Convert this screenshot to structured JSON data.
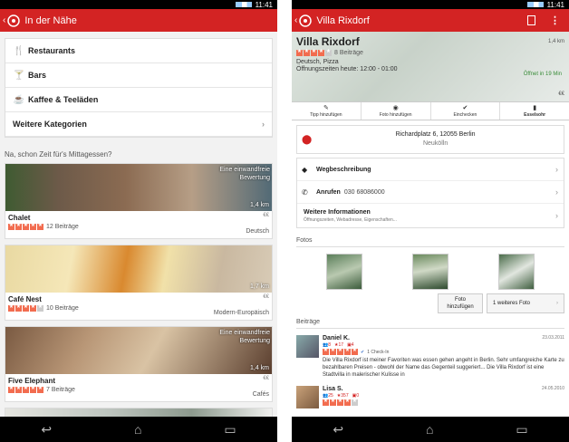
{
  "status": {
    "time_left": "11:41",
    "time_right": "11:41"
  },
  "p1": {
    "title": "In der Nähe",
    "categories": [
      {
        "icon": "fork-knife-icon",
        "glyph": "🍴",
        "label": "Restaurants"
      },
      {
        "icon": "cocktail-icon",
        "glyph": "🍸",
        "label": "Bars"
      },
      {
        "icon": "coffee-cup-icon",
        "glyph": "☕",
        "label": "Kaffee & Teeläden"
      }
    ],
    "more_categories": "Weitere Kategorien",
    "section_title": "Na, schon Zeit für's Mittagessen?",
    "cards": [
      {
        "name": "Chalet",
        "reviews": "12 Beiträge",
        "price": "€€",
        "cuisine": "Deutsch",
        "distance": "1,4 km",
        "badge": "Eine einwandfreie Bewertung",
        "rating": 5
      },
      {
        "name": "Café Nest",
        "reviews": "10 Beiträge",
        "price": "€€",
        "cuisine": "Modern-Europäisch",
        "distance": "1,7 km",
        "badge": "",
        "rating": 4
      },
      {
        "name": "Five Elephant",
        "reviews": "7 Beiträge",
        "price": "€€",
        "cuisine": "Cafés",
        "distance": "1,4 km",
        "badge": "Eine einwandfreie Bewertung",
        "rating": 5
      }
    ]
  },
  "p2": {
    "title": "Villa Rixdorf",
    "name": "Villa Rixdorf",
    "distance": "1,4 km",
    "reviews": "8 Beiträge",
    "price": "€€",
    "rating": 4,
    "categories": "Deutsch, Pizza",
    "hours": "Öffnungszeiten heute: 12:00 - 01:00",
    "opens_in": "Öffnet in 19 Min",
    "actions": [
      "Tipp hinzufügen",
      "Foto hinzufügen",
      "Einchecken",
      "Esselsohr"
    ],
    "address1": "Richardplatz 6, 12055 Berlin",
    "address2": "Neukölln",
    "directions": "Wegbeschreibung",
    "call_label": "Anrufen",
    "phone": "030 68086000",
    "more_info": "Weitere Informationen",
    "more_info_sub": "Öffnungszeiten, Webadresse, Eigenschaften...",
    "photos_title": "Fotos",
    "add_photo": "Foto hinzufügen",
    "more_photos": "1 weiteres Foto",
    "reviews_title": "Beiträge",
    "review1": {
      "name": "Daniel K.",
      "date": "23.03.2011",
      "friends": "8",
      "reviews_count": "17",
      "photos": "4",
      "checkin": "1 Check-In",
      "rating": 5,
      "text": "Die Villa Rixdorf ist meiner Favoriten was essen gehen angeht in Berlin. Sehr umfangreiche Karte zu bezahlbaren Preisen - obwohl der Name das Gegenteil suggeriert...  Die Villa Rixdorf ist eine Stadtvilla in malerischer Kulisse in"
    },
    "review2": {
      "name": "Lisa S.",
      "date": "24.05.2010",
      "friends": "25",
      "reviews_count": "357",
      "photos": "0",
      "rating": 4
    }
  }
}
